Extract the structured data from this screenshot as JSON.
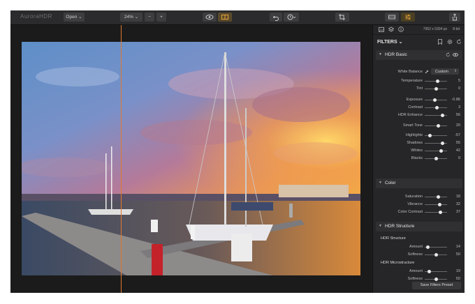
{
  "toolbar": {
    "logo": "AuroraHDR",
    "open_label": "Open ⌄",
    "zoom_label": "24% ⌄",
    "zoom_out": "−",
    "zoom_in": "+"
  },
  "panel": {
    "image_info": "7952 x 5304 px",
    "bit_depth": "8-bit",
    "filters_label": "FILTERS ⌄",
    "hdr_basic": {
      "title": "HDR Basic",
      "white_balance_label": "White Balance",
      "white_balance_value": "Custom",
      "sliders": [
        {
          "label": "Temperature",
          "value": "5",
          "pos": 0.55
        },
        {
          "label": "Tint",
          "value": "0",
          "pos": 0.5
        },
        {
          "label": "Exposure",
          "value": "-0.86",
          "pos": 0.45
        },
        {
          "label": "Contrast",
          "value": "3",
          "pos": 0.52
        },
        {
          "label": "HDR Enhance",
          "value": "56",
          "pos": 0.78
        },
        {
          "label": "Smart Tone",
          "value": "20",
          "pos": 0.6
        },
        {
          "label": "Highlights",
          "value": "-57",
          "pos": 0.22
        },
        {
          "label": "Shadows",
          "value": "55",
          "pos": 0.78
        },
        {
          "label": "Whites",
          "value": "42",
          "pos": 0.71
        },
        {
          "label": "Blacks",
          "value": "0",
          "pos": 0.5
        }
      ]
    },
    "color": {
      "title": "Color",
      "sliders": [
        {
          "label": "Saturation",
          "value": "18",
          "pos": 0.59
        },
        {
          "label": "Vibrance",
          "value": "32",
          "pos": 0.66
        },
        {
          "label": "Color Contrast",
          "value": "37",
          "pos": 0.69
        }
      ]
    },
    "hdr_structure": {
      "title": "HDR Structure",
      "structure_label": "HDR Structure",
      "structure": [
        {
          "label": "Amount",
          "value": "14",
          "pos": 0.14
        },
        {
          "label": "Softness",
          "value": "50",
          "pos": 0.5
        }
      ],
      "micro_label": "HDR Microstructure",
      "micro": [
        {
          "label": "Amount",
          "value": "19",
          "pos": 0.19
        },
        {
          "label": "Softness",
          "value": "50",
          "pos": 0.5
        }
      ]
    },
    "save_preset": "Save Filters Preset"
  }
}
